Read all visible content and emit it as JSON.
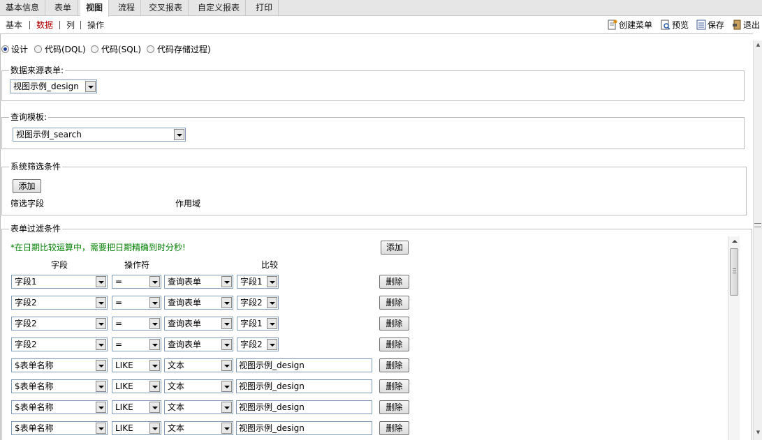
{
  "tabs": [
    "基本信息",
    "表单",
    "视图",
    "流程",
    "交叉报表",
    "自定义报表",
    "打印"
  ],
  "active_tab": "视图",
  "subtabs": [
    "基本",
    "数据",
    "列",
    "操作"
  ],
  "active_subtab": "数据",
  "toolbar": {
    "create_menu": "创建菜单",
    "preview": "预览",
    "save": "保存",
    "exit": "退出"
  },
  "mode": {
    "options": [
      "设计",
      "代码(DQL)",
      "代码(SQL)",
      "代码存储过程)"
    ],
    "selected": "设计"
  },
  "datasource": {
    "legend": "数据来源表单:",
    "value": "视图示例_design"
  },
  "query_template": {
    "legend": "查询模板:",
    "value": "视图示例_search"
  },
  "system_filter": {
    "legend": "系统筛选条件",
    "add_label": "添加",
    "col_field": "筛选字段",
    "col_scope": "作用域"
  },
  "form_filter": {
    "legend": "表单过滤条件",
    "note": "*在日期比较运算中，需要把日期精确到时分秒!",
    "add_label": "添加",
    "headers": {
      "field": "字段",
      "operator": "操作符",
      "compare": "比较"
    },
    "delete_label": "删除",
    "rows": [
      {
        "field": "字段1",
        "op": "=",
        "source": "查询表单",
        "target": "字段1",
        "text": ""
      },
      {
        "field": "字段2",
        "op": "=",
        "source": "查询表单",
        "target": "字段2",
        "text": ""
      },
      {
        "field": "字段2",
        "op": "=",
        "source": "查询表单",
        "target": "字段1",
        "text": ""
      },
      {
        "field": "字段2",
        "op": "=",
        "source": "查询表单",
        "target": "字段2",
        "text": ""
      },
      {
        "field": "$表单名称",
        "op": "LIKE",
        "source": "文本",
        "target": "",
        "text": "视图示例_design"
      },
      {
        "field": "$表单名称",
        "op": "LIKE",
        "source": "文本",
        "target": "",
        "text": "视图示例_design"
      },
      {
        "field": "$表单名称",
        "op": "LIKE",
        "source": "文本",
        "target": "",
        "text": "视图示例_design"
      },
      {
        "field": "$表单名称",
        "op": "LIKE",
        "source": "文本",
        "target": "",
        "text": "视图示例_design"
      }
    ]
  },
  "colors": {
    "note_green": "#008000",
    "active_subtab": "#b00000",
    "tabbar_bg": "#e6e6e6"
  },
  "icons": [
    "create-menu-icon",
    "preview-icon",
    "save-icon",
    "exit-icon"
  ]
}
